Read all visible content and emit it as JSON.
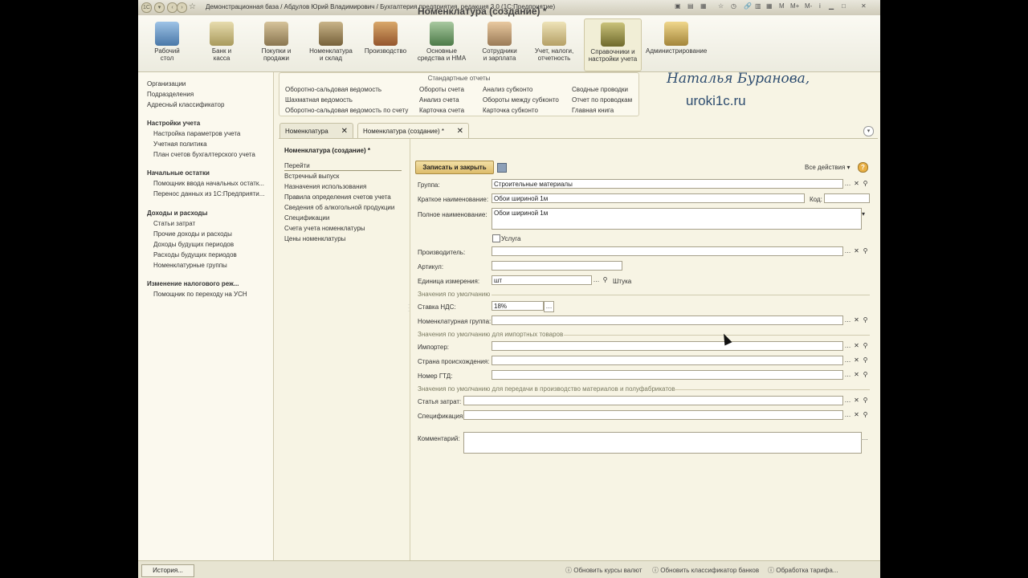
{
  "window": {
    "title": "Демонстрационная база / Абдулов Юрий Владимирович / Бухгалтерия предприятия, редакция 3.0 (1С:Предприятие)",
    "controls": [
      "M",
      "M+",
      "M-"
    ]
  },
  "toolbar": {
    "sections": [
      {
        "line1": "Рабочий",
        "line2": "стол",
        "icon": "desktop-icon"
      },
      {
        "line1": "Банк и",
        "line2": "касса",
        "icon": "bank-icon"
      },
      {
        "line1": "Покупки и",
        "line2": "продажи",
        "icon": "truck-icon"
      },
      {
        "line1": "Номенклатура",
        "line2": "и склад",
        "icon": "warehouse-icon"
      },
      {
        "line1": "Производство",
        "line2": "",
        "icon": "production-icon"
      },
      {
        "line1": "Основные",
        "line2": "средства и НМА",
        "icon": "assets-icon"
      },
      {
        "line1": "Сотрудники",
        "line2": "и зарплата",
        "icon": "employees-icon"
      },
      {
        "line1": "Учет, налоги,",
        "line2": "отчетность",
        "icon": "reports-icon"
      },
      {
        "line1": "Справочники и",
        "line2": "настройки учета",
        "icon": "catalogs-icon"
      },
      {
        "line1": "Администрирование",
        "line2": "",
        "icon": "admin-icon"
      }
    ]
  },
  "left_panel": {
    "top_items": [
      "Организации",
      "Подразделения",
      "Адресный классификатор"
    ],
    "groups": [
      {
        "title": "Настройки учета",
        "items": [
          "Настройка параметров учета",
          "Учетная политика",
          "План счетов бухгалтерского учета"
        ]
      },
      {
        "title": "Начальные остатки",
        "items": [
          "Помощник ввода начальных остатк...",
          "Перенос данных из 1С:Предприяти..."
        ]
      },
      {
        "title": "Доходы и расходы",
        "items": [
          "Статьи затрат",
          "Прочие доходы и расходы",
          "Доходы будущих периодов",
          "Расходы будущих периодов",
          "Номенклатурные группы"
        ]
      },
      {
        "title": "Изменение налогового реж...",
        "items": [
          "Помощник по переходу на УСН"
        ]
      }
    ]
  },
  "reports": {
    "title": "Стандартные отчеты",
    "col1": [
      "Оборотно-сальдовая ведомость",
      "Шахматная ведомость",
      "Оборотно-сальдовая ведомость по счету"
    ],
    "col2": [
      "Обороты счета",
      "Анализ счета",
      "Карточка счета"
    ],
    "col3": [
      "Анализ субконто",
      "Обороты между субконто",
      "Карточка субконто"
    ],
    "col4": [
      "Сводные проводки",
      "Отчет по проводкам",
      "Главная книга"
    ]
  },
  "brand": {
    "name": "Наталья Буранова,",
    "site": "uroki1c.ru"
  },
  "tabs": [
    {
      "label": "Номенклатура"
    },
    {
      "label": "Номенклатура (создание) *"
    }
  ],
  "nav": {
    "title": "Номенклатура (создание) *",
    "go": "Перейти",
    "items": [
      "Встречный выпуск",
      "Назначения использования",
      "Правила определения счетов учета",
      "Сведения об алкогольной продукции",
      "Спецификации",
      "Счета учета номенклатуры",
      "Цены номенклатуры"
    ]
  },
  "form": {
    "title": "Номенклатура (создание) *",
    "save_close": "Записать и закрыть",
    "all_actions": "Все действия ▾",
    "help": "?",
    "labels": {
      "group": "Группа:",
      "short_name": "Краткое наименование:",
      "code": "Код:",
      "full_name": "Полное наименование:",
      "service": "Услуга",
      "manufacturer": "Производитель:",
      "article": "Артикул:",
      "unit": "Единица измерения:",
      "unit_name": "Штука",
      "defaults": "Значения по умолчанию",
      "vat": "Ставка НДС:",
      "nom_group": "Номенклатурная группа:",
      "import_defaults": "Значения по умолчанию для импортных товаров",
      "importer": "Импортер:",
      "country": "Страна происхождения:",
      "gtd": "Номер ГТД:",
      "production_defaults": "Значения по умолчанию для передачи в производство материалов и полуфабрикатов",
      "cost_item": "Статья затрат:",
      "specification": "Спецификация:",
      "comment": "Комментарий:"
    },
    "values": {
      "group": "Строительные материалы",
      "short_name": "Обои шириной 1м",
      "code": "",
      "full_name": "Обои шириной 1м",
      "manufacturer": "",
      "article": "",
      "unit": "шт",
      "vat": "18%",
      "nom_group": "",
      "importer": "",
      "country": "",
      "gtd": "",
      "cost_item": "",
      "specification": "",
      "comment": ""
    }
  },
  "status": {
    "history": "История...",
    "links": [
      "Обновить курсы валют",
      "Обновить классификатор банков",
      "Обработка тарифа..."
    ]
  },
  "colors": {
    "accent": "#ddbc6b",
    "brand": "#2d4c6f",
    "background": "#f7f4e4"
  }
}
